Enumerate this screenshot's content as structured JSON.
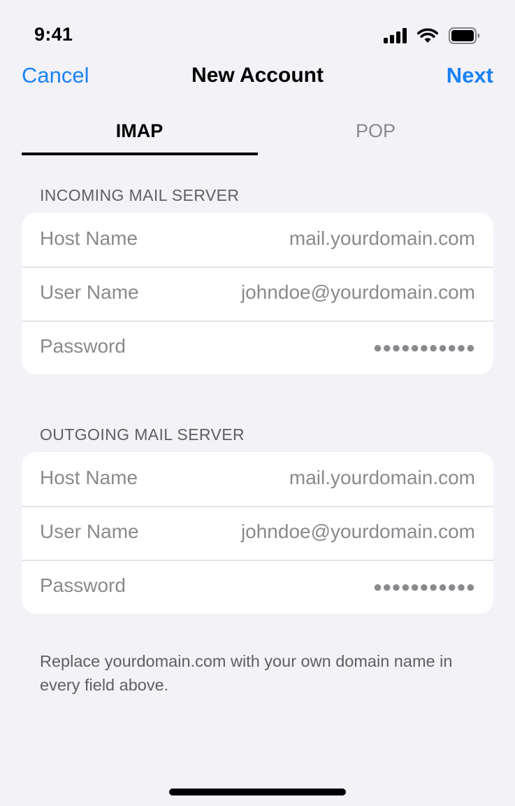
{
  "status_bar": {
    "time": "9:41",
    "icons": [
      "cellular-signal-icon",
      "wifi-icon",
      "battery-icon"
    ]
  },
  "nav": {
    "cancel_label": "Cancel",
    "title": "New Account",
    "next_label": "Next"
  },
  "tabs": [
    {
      "label": "IMAP",
      "selected": true
    },
    {
      "label": "POP",
      "selected": false
    }
  ],
  "incoming": {
    "header": "INCOMING MAIL SERVER",
    "rows": [
      {
        "label": "Host Name",
        "value": "mail.yourdomain.com"
      },
      {
        "label": "User Name",
        "value": "johndoe@yourdomain.com"
      },
      {
        "label": "Password",
        "value": "●●●●●●●●●●●"
      }
    ]
  },
  "outgoing": {
    "header": "OUTGOING MAIL SERVER",
    "rows": [
      {
        "label": "Host Name",
        "value": "mail.yourdomain.com"
      },
      {
        "label": "User Name",
        "value": "johndoe@yourdomain.com"
      },
      {
        "label": "Password",
        "value": "●●●●●●●●●●●"
      }
    ]
  },
  "footer": {
    "note": "Replace yourdomain.com with your own domain name in every field above."
  },
  "colors": {
    "accent": "#1a82f7",
    "background": "#f2f2f7",
    "card": "#ffffff",
    "secondary_text": "#8a8a8e"
  }
}
